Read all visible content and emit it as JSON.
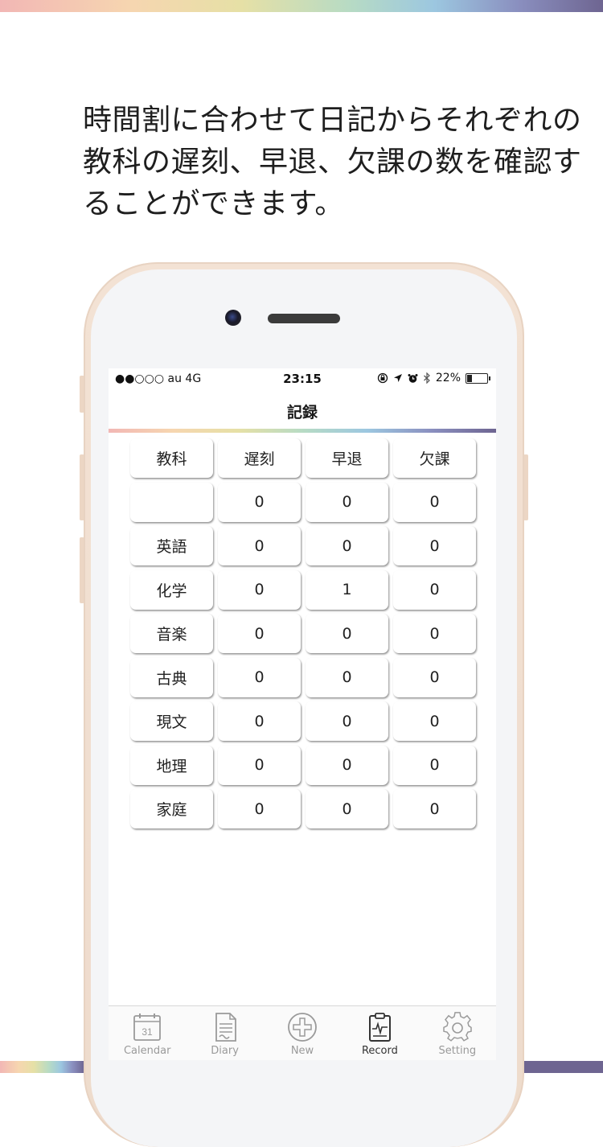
{
  "caption": [
    "時間割に合わせて日記からそれぞれの",
    "教科の遅刻、早退、欠課の数を確認す",
    "ることができます。"
  ],
  "status_bar": {
    "carrier": "●●○○○ au  4G",
    "time": "23:15",
    "battery_percent": "22%"
  },
  "nav": {
    "title": "記録"
  },
  "table": {
    "headers": [
      "教科",
      "遅刻",
      "早退",
      "欠課"
    ],
    "rows": [
      [
        "",
        "0",
        "0",
        "0"
      ],
      [
        "英語",
        "0",
        "0",
        "0"
      ],
      [
        "化学",
        "0",
        "1",
        "0"
      ],
      [
        "音楽",
        "0",
        "0",
        "0"
      ],
      [
        "古典",
        "0",
        "0",
        "0"
      ],
      [
        "現文",
        "0",
        "0",
        "0"
      ],
      [
        "地理",
        "0",
        "0",
        "0"
      ],
      [
        "家庭",
        "0",
        "0",
        "0"
      ]
    ]
  },
  "tabs": [
    {
      "label": "Calendar",
      "icon": "calendar-icon",
      "badge": "31",
      "active": false
    },
    {
      "label": "Diary",
      "icon": "diary-icon",
      "active": false
    },
    {
      "label": "New",
      "icon": "plus-circle-icon",
      "active": false
    },
    {
      "label": "Record",
      "icon": "record-icon",
      "active": true
    },
    {
      "label": "Setting",
      "icon": "gear-icon",
      "active": false
    }
  ],
  "colors": {
    "rainbow": [
      "#f2b7b5",
      "#f6d6b0",
      "#e6e0a6",
      "#b7dbc4",
      "#9cc7e0",
      "#8a8fbf",
      "#6e6591"
    ],
    "phone_frame": "#f3e2d4"
  }
}
